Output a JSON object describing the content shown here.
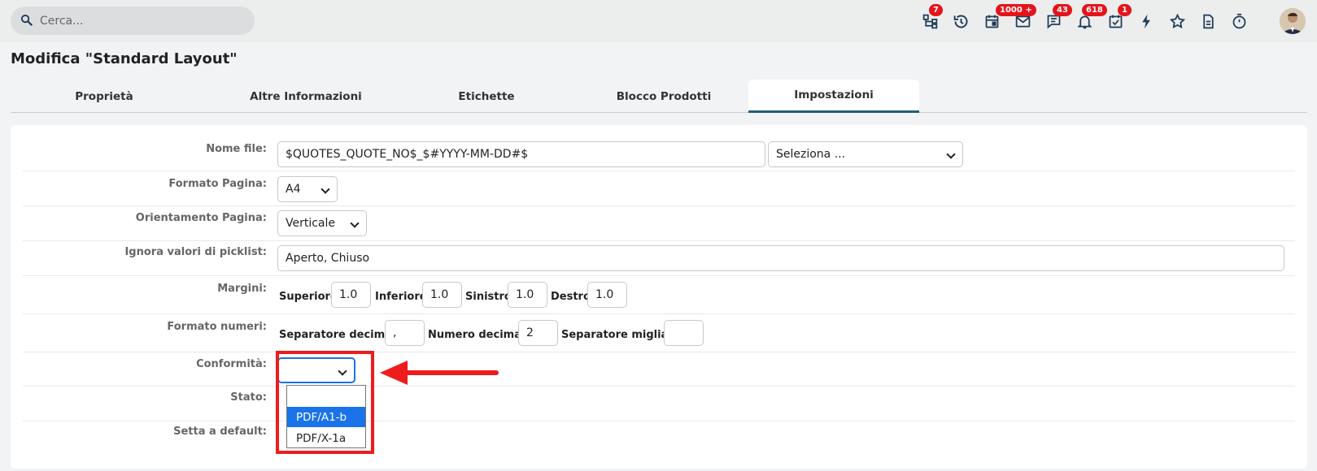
{
  "search": {
    "placeholder": "Cerca..."
  },
  "toolbar": {
    "icons": [
      {
        "name": "hierarchy-icon",
        "badge": "7"
      },
      {
        "name": "history-icon",
        "badge": ""
      },
      {
        "name": "calendar-icon",
        "badge": ""
      },
      {
        "name": "mail-icon",
        "badge": "1000 +"
      },
      {
        "name": "chat-icon",
        "badge": "43"
      },
      {
        "name": "bell-icon",
        "badge": "618"
      },
      {
        "name": "task-check-icon",
        "badge": "1"
      },
      {
        "name": "lightning-icon",
        "badge": ""
      },
      {
        "name": "star-icon",
        "badge": ""
      },
      {
        "name": "document-icon",
        "badge": ""
      },
      {
        "name": "stopwatch-icon",
        "badge": ""
      }
    ],
    "badge_color": "#e3141b"
  },
  "page": {
    "title": "Modifica \"Standard Layout\""
  },
  "tabs": [
    {
      "label": "Proprietà"
    },
    {
      "label": "Altre Informazioni"
    },
    {
      "label": "Etichette"
    },
    {
      "label": "Blocco Prodotti"
    },
    {
      "label": "Impostazioni",
      "active": true
    }
  ],
  "form": {
    "nome_file": {
      "label": "Nome file:",
      "value": "$QUOTES_QUOTE_NO$_$#YYYY-MM-DD#$",
      "select_value": "Seleziona ..."
    },
    "formato_pagina": {
      "label": "Formato Pagina:",
      "value": "A4"
    },
    "orientamento": {
      "label": "Orientamento Pagina:",
      "value": "Verticale"
    },
    "ignora": {
      "label": "Ignora valori di picklist:",
      "value": "Aperto, Chiuso"
    },
    "margini": {
      "label": "Margini:",
      "superiore_label": "Superiore",
      "superiore": "1.0",
      "inferiore_label": "Inferiore",
      "inferiore": "1.0",
      "sinistro_label": "Sinistro",
      "sinistro": "1.0",
      "destro_label": "Destro",
      "destro": "1.0"
    },
    "formato_numeri": {
      "label": "Formato numeri:",
      "sep_decimali_label": "Separatore decimali",
      "sep_decimali": ",",
      "num_decimali_label": "Numero decimali",
      "num_decimali": "2",
      "sep_migliaia_label": "Separatore migliaia",
      "sep_migliaia": ""
    },
    "conformita": {
      "label": "Conformità:",
      "value": "",
      "options": [
        "",
        "PDF/A1-b",
        "PDF/X-1a"
      ],
      "highlighted": "PDF/A1-b"
    },
    "stato": {
      "label": "Stato:"
    },
    "setta_default": {
      "label": "Setta a default:"
    }
  },
  "annotation": {
    "color": "#ee1c1c"
  }
}
